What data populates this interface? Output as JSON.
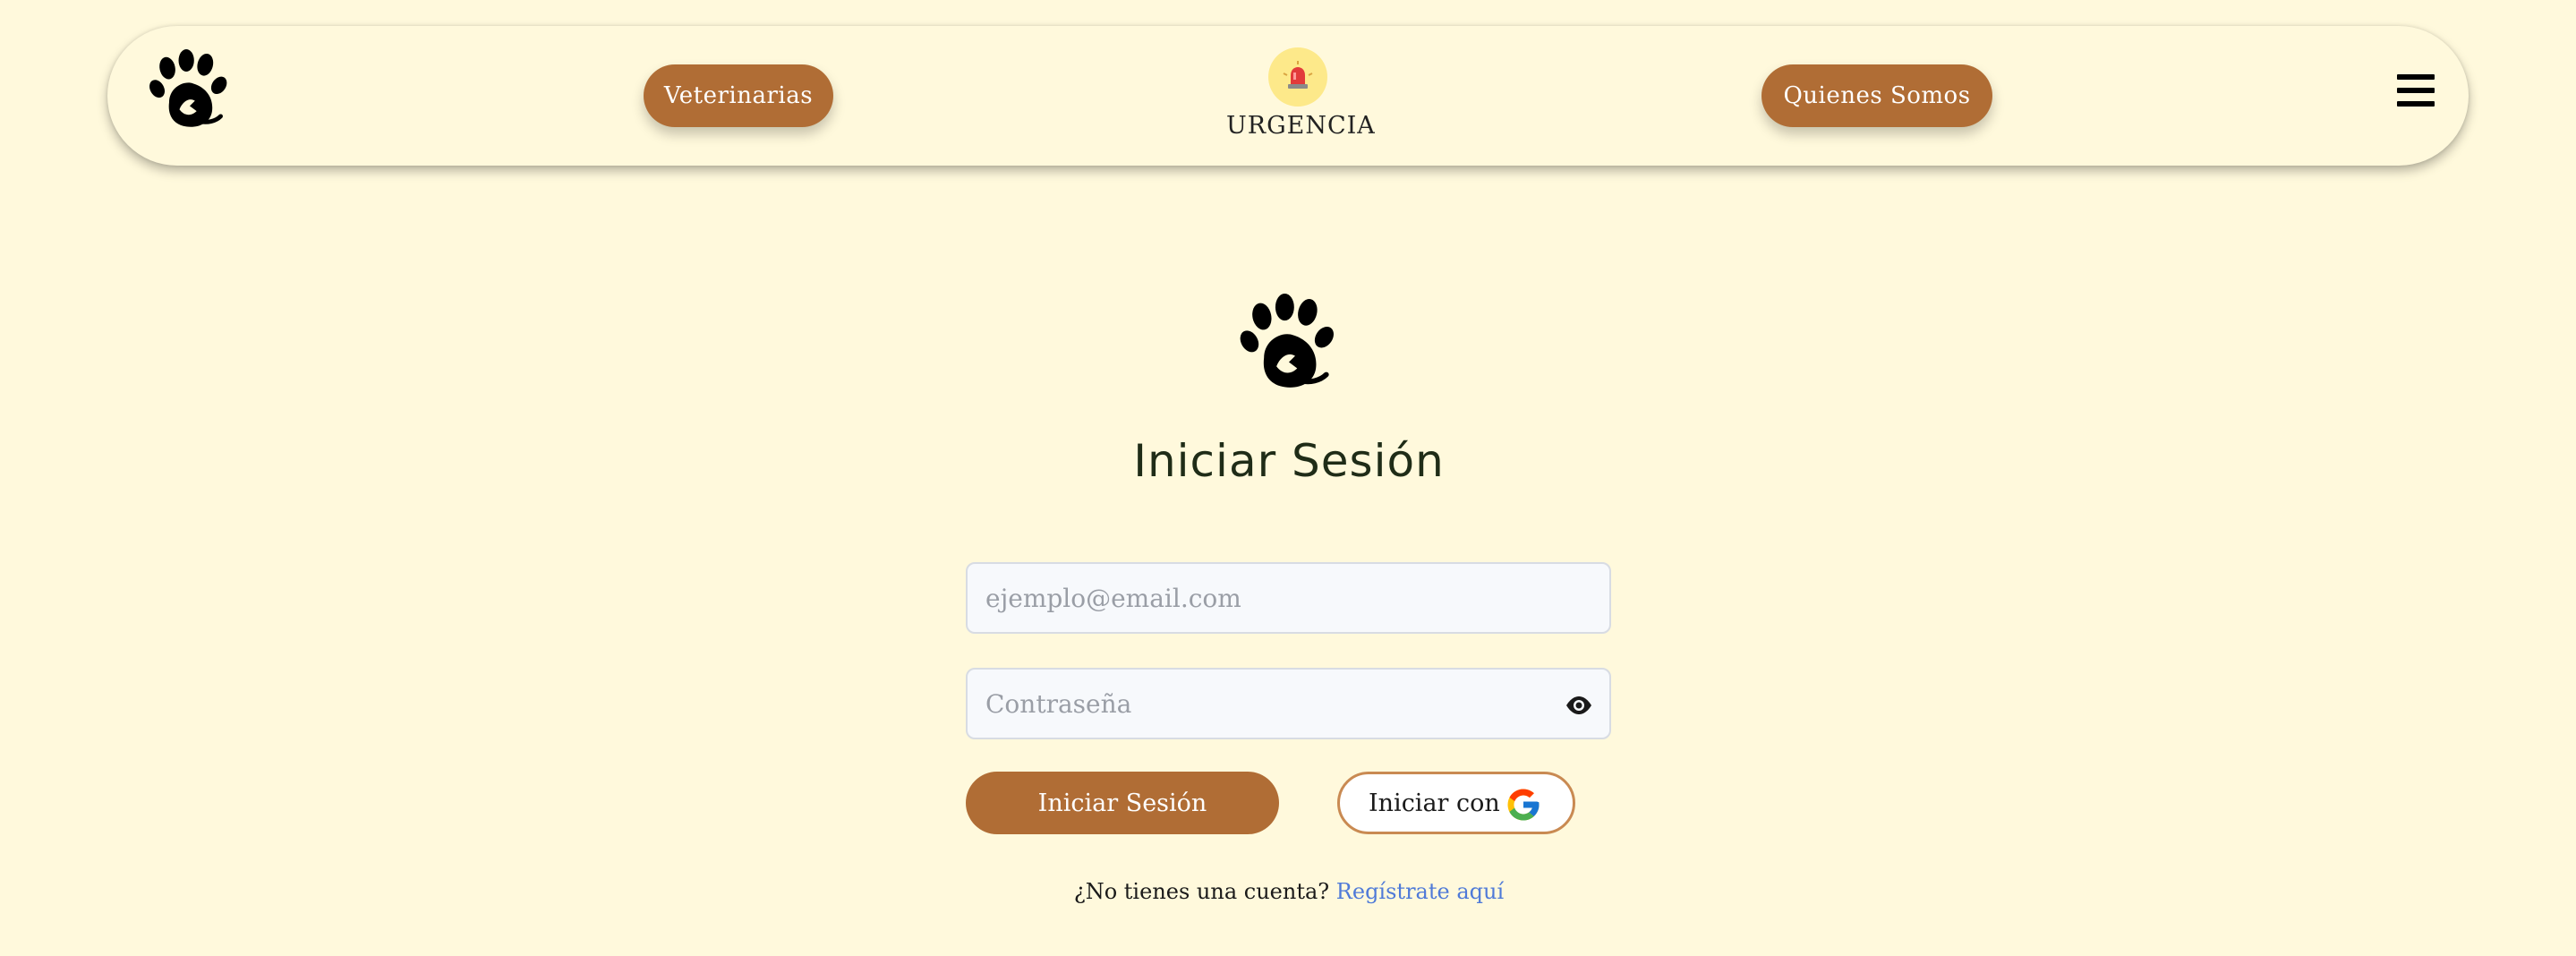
{
  "header": {
    "logo_icon": "paw-dog-logo-icon",
    "nav_veterinarias": "Veterinarias",
    "urgency_icon": "siren-icon",
    "urgency_label": "URGENCIA",
    "nav_about": "Quienes Somos",
    "menu_icon": "hamburger-menu-icon"
  },
  "login": {
    "logo_icon": "paw-dog-logo-icon",
    "title": "Iniciar Sesión",
    "email_placeholder": "ejemplo@email.com",
    "password_placeholder": "Contraseña",
    "password_toggle_icon": "eye-icon",
    "submit_label": "Iniciar Sesión",
    "google_label": "Iniciar con",
    "google_icon": "google-g-icon",
    "signup_prompt": "¿No tienes una cuenta?",
    "signup_link": "Regístrate aquí"
  },
  "colors": {
    "background": "#fff9dc",
    "accent_brown": "#b06d35",
    "title_text": "#1f2c17",
    "link_blue": "#4f7ad8",
    "urgency_badge": "#fde98a",
    "siren_red": "#e23b3b"
  }
}
